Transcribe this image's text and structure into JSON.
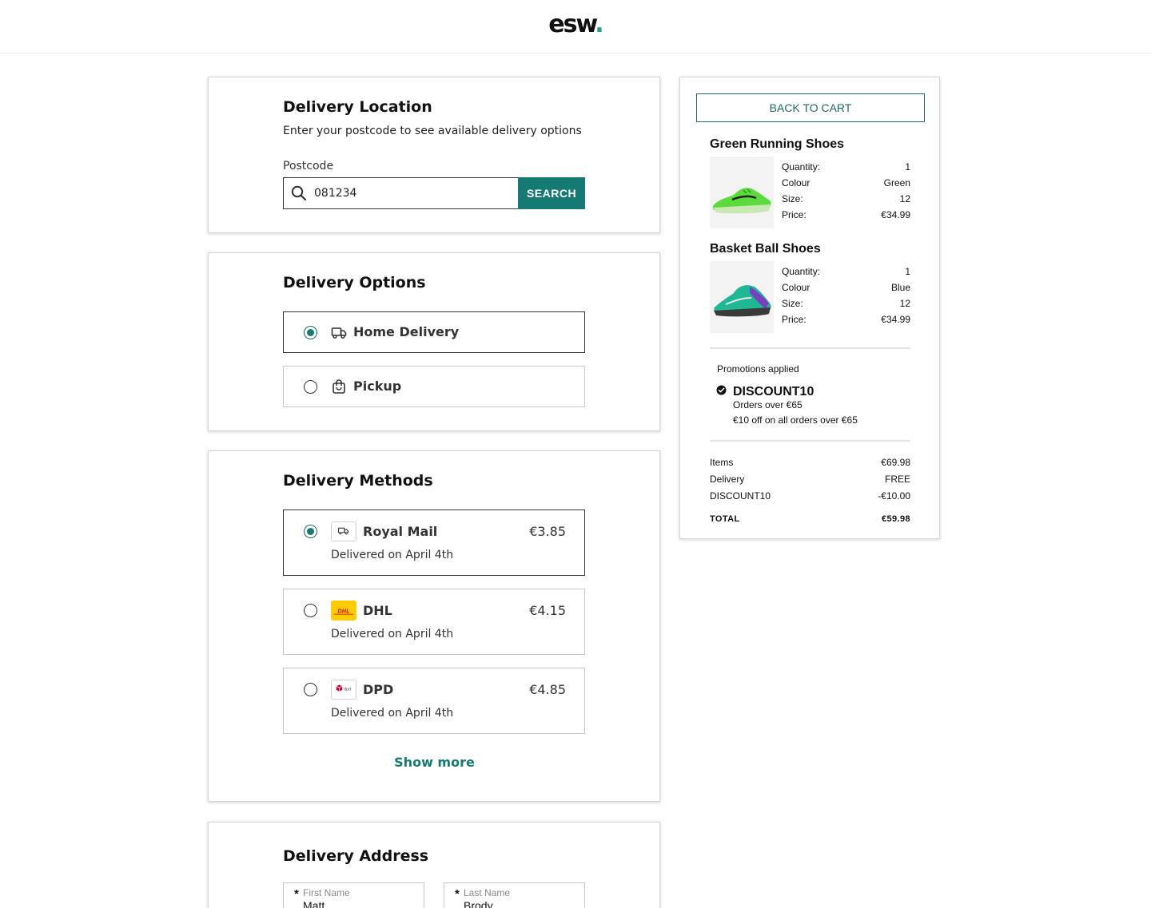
{
  "header": {
    "logo_text": "esw",
    "logo_dot": "."
  },
  "delivery_location": {
    "title": "Delivery Location",
    "subtitle": "Enter your postcode to see available delivery options",
    "postcode_label": "Postcode",
    "postcode_value": "081234",
    "search_button": "SEARCH"
  },
  "delivery_options": {
    "title": "Delivery Options",
    "items": [
      {
        "label": "Home Delivery",
        "icon": "truck-icon",
        "selected": true
      },
      {
        "label": "Pickup",
        "icon": "shopping-bag-icon",
        "selected": false
      }
    ]
  },
  "delivery_methods": {
    "title": "Delivery Methods",
    "items": [
      {
        "carrier": "Royal Mail",
        "price": "€3.85",
        "date": "Delivered on April 4th",
        "icon": "truck-icon",
        "selected": true
      },
      {
        "carrier": "DHL",
        "price": "€4.15",
        "date": "Delivered on April 4th",
        "icon": "dhl-logo",
        "selected": false
      },
      {
        "carrier": "DPD",
        "price": "€4.85",
        "date": "Delivered on April 4th",
        "icon": "dpd-logo",
        "selected": false
      }
    ],
    "show_more": "Show more"
  },
  "delivery_address": {
    "title": "Delivery Address",
    "first_name": {
      "required_mark": "*",
      "label": "First Name",
      "value": "Matt"
    },
    "last_name": {
      "required_mark": "*",
      "label": "Last Name",
      "value": "Brody"
    }
  },
  "summary": {
    "back_button": "BACK TO CART",
    "products": [
      {
        "name": "Green Running Shoes",
        "image": "green-running-shoe-image",
        "specs": [
          {
            "label": "Quantity:",
            "value": "1"
          },
          {
            "label": "Colour",
            "value": "Green"
          },
          {
            "label": "Size:",
            "value": "12"
          },
          {
            "label": "Price:",
            "value": "€34.99"
          }
        ]
      },
      {
        "name": "Basket Ball Shoes",
        "image": "basketball-shoe-image",
        "specs": [
          {
            "label": "Quantity:",
            "value": "1"
          },
          {
            "label": "Colour",
            "value": "Blue"
          },
          {
            "label": "Size:",
            "value": "12"
          },
          {
            "label": "Price:",
            "value": "€34.99"
          }
        ]
      }
    ],
    "promotions": {
      "heading": "Promotions applied",
      "code": "DISCOUNT10",
      "line1": "Orders over €65",
      "line2": "€10 off on all orders over €65"
    },
    "totals": [
      {
        "label": "Items",
        "value": "€69.98"
      },
      {
        "label": "Delivery",
        "value": "FREE"
      },
      {
        "label": "DISCOUNT10",
        "value": "-€10.00"
      }
    ],
    "grand_total": {
      "label": "TOTAL",
      "value": "€59.98"
    }
  },
  "colors": {
    "accent": "#157a72",
    "dhl_yellow": "#ffcc00",
    "dhl_red": "#d40511",
    "dpd_red": "#dc0032"
  }
}
